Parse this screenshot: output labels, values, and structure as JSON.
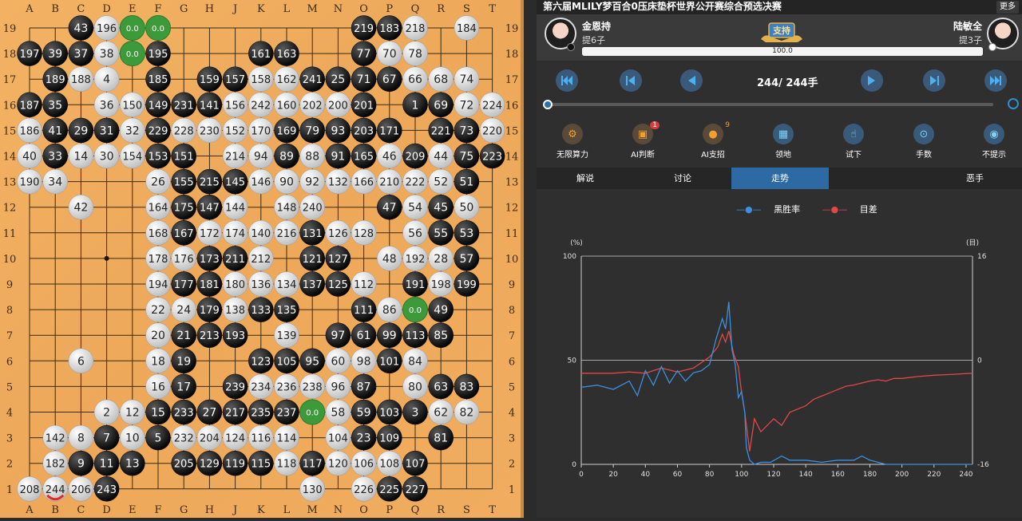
{
  "match_title": "第六届MLILY梦百合0压床垫杯世界公开赛综合预选决赛",
  "more_label": "更多",
  "black_player": {
    "name": "金恩持",
    "captures": "提6子"
  },
  "white_player": {
    "name": "陆敏全",
    "captures": "提3子"
  },
  "support_label": "支持",
  "win_progress": {
    "value": "100.0",
    "fraction": 1.0
  },
  "move_counter": "244/ 244手",
  "tools": [
    {
      "label": "无限算力",
      "icon": "compute-icon",
      "badge": ""
    },
    {
      "label": "AI判断",
      "icon": "ai-judge-icon",
      "badge": "1"
    },
    {
      "label": "AI支招",
      "icon": "bulb-icon",
      "badge": "9"
    },
    {
      "label": "领地",
      "icon": "territory-icon",
      "badge": ""
    },
    {
      "label": "试下",
      "icon": "hand-icon",
      "badge": ""
    },
    {
      "label": "手数",
      "icon": "move-number-icon",
      "badge": ""
    },
    {
      "label": "不提示",
      "icon": "eye-icon",
      "badge": ""
    }
  ],
  "tabs": [
    {
      "label": "解说",
      "active": false
    },
    {
      "label": "讨论",
      "active": false
    },
    {
      "label": "走势",
      "active": true
    },
    {
      "label": "",
      "active": false
    },
    {
      "label": "恶手",
      "active": false
    }
  ],
  "board": {
    "cols": [
      "A",
      "B",
      "C",
      "D",
      "E",
      "F",
      "G",
      "H",
      "J",
      "K",
      "L",
      "M",
      "N",
      "O",
      "P",
      "Q",
      "R",
      "S",
      "T"
    ],
    "rows": [
      "19",
      "18",
      "17",
      "16",
      "15",
      "14",
      "13",
      "12",
      "11",
      "10",
      "9",
      "8",
      "7",
      "6",
      "5",
      "4",
      "3",
      "2",
      "1"
    ],
    "stones": [
      [
        "C19",
        "b",
        43
      ],
      [
        "D19",
        "w",
        196
      ],
      [
        "O19",
        "b",
        219
      ],
      [
        "P19",
        "b",
        183
      ],
      [
        "Q19",
        "w",
        218
      ],
      [
        "S19",
        "w",
        184
      ],
      [
        "A18",
        "b",
        197
      ],
      [
        "B18",
        "b",
        39
      ],
      [
        "C18",
        "b",
        37
      ],
      [
        "D18",
        "w",
        38
      ],
      [
        "F18",
        "b",
        195
      ],
      [
        "K18",
        "b",
        161
      ],
      [
        "L18",
        "b",
        163
      ],
      [
        "O18",
        "b",
        77
      ],
      [
        "P18",
        "w",
        70
      ],
      [
        "Q18",
        "w",
        78
      ],
      [
        "B17",
        "b",
        189
      ],
      [
        "C17",
        "w",
        188
      ],
      [
        "D17",
        "w",
        4
      ],
      [
        "F17",
        "b",
        185
      ],
      [
        "H17",
        "b",
        159
      ],
      [
        "J17",
        "b",
        157
      ],
      [
        "K17",
        "w",
        158
      ],
      [
        "L17",
        "w",
        162
      ],
      [
        "M17",
        "b",
        241
      ],
      [
        "N17",
        "b",
        25
      ],
      [
        "O17",
        "b",
        71
      ],
      [
        "P17",
        "b",
        67
      ],
      [
        "Q17",
        "w",
        66
      ],
      [
        "R17",
        "w",
        68
      ],
      [
        "S17",
        "w",
        74
      ],
      [
        "A16",
        "b",
        187
      ],
      [
        "B16",
        "b",
        35
      ],
      [
        "D16",
        "w",
        36
      ],
      [
        "E16",
        "w",
        150
      ],
      [
        "F16",
        "b",
        149
      ],
      [
        "G16",
        "b",
        231
      ],
      [
        "H16",
        "b",
        141
      ],
      [
        "J16",
        "w",
        156
      ],
      [
        "K16",
        "w",
        242
      ],
      [
        "L16",
        "w",
        160
      ],
      [
        "M16",
        "w",
        202
      ],
      [
        "N16",
        "w",
        200
      ],
      [
        "O16",
        "b",
        201
      ],
      [
        "Q16",
        "b",
        1
      ],
      [
        "R16",
        "b",
        69
      ],
      [
        "S16",
        "w",
        72
      ],
      [
        "T16",
        "w",
        224
      ],
      [
        "A15",
        "w",
        186
      ],
      [
        "B15",
        "b",
        41
      ],
      [
        "C15",
        "b",
        29
      ],
      [
        "D15",
        "b",
        31
      ],
      [
        "E15",
        "w",
        32
      ],
      [
        "F15",
        "b",
        229
      ],
      [
        "G15",
        "w",
        228
      ],
      [
        "H15",
        "w",
        230
      ],
      [
        "J15",
        "w",
        152
      ],
      [
        "K15",
        "w",
        170
      ],
      [
        "L15",
        "b",
        169
      ],
      [
        "M15",
        "b",
        79
      ],
      [
        "N15",
        "b",
        93
      ],
      [
        "O15",
        "b",
        203
      ],
      [
        "P15",
        "b",
        171
      ],
      [
        "R15",
        "b",
        221
      ],
      [
        "S15",
        "b",
        73
      ],
      [
        "T15",
        "w",
        220
      ],
      [
        "A14",
        "w",
        40
      ],
      [
        "B14",
        "b",
        33
      ],
      [
        "C14",
        "w",
        14
      ],
      [
        "D14",
        "w",
        30
      ],
      [
        "E14",
        "w",
        154
      ],
      [
        "F14",
        "b",
        153
      ],
      [
        "G14",
        "b",
        151
      ],
      [
        "J14",
        "w",
        214
      ],
      [
        "K14",
        "w",
        94
      ],
      [
        "L14",
        "b",
        89
      ],
      [
        "M14",
        "w",
        88
      ],
      [
        "N14",
        "b",
        91
      ],
      [
        "O14",
        "b",
        165
      ],
      [
        "P14",
        "w",
        46
      ],
      [
        "Q14",
        "b",
        209
      ],
      [
        "R14",
        "w",
        44
      ],
      [
        "S14",
        "b",
        75
      ],
      [
        "T14",
        "b",
        223
      ],
      [
        "A13",
        "w",
        190
      ],
      [
        "B13",
        "w",
        34
      ],
      [
        "F13",
        "w",
        26
      ],
      [
        "G13",
        "b",
        155
      ],
      [
        "H13",
        "b",
        215
      ],
      [
        "J13",
        "b",
        145
      ],
      [
        "K13",
        "w",
        146
      ],
      [
        "L13",
        "w",
        90
      ],
      [
        "M13",
        "w",
        92
      ],
      [
        "N13",
        "w",
        132
      ],
      [
        "O13",
        "w",
        166
      ],
      [
        "P13",
        "w",
        210
      ],
      [
        "Q13",
        "w",
        222
      ],
      [
        "R13",
        "w",
        52
      ],
      [
        "S13",
        "b",
        51
      ],
      [
        "C12",
        "w",
        42
      ],
      [
        "F12",
        "w",
        164
      ],
      [
        "G12",
        "b",
        175
      ],
      [
        "H12",
        "b",
        147
      ],
      [
        "J12",
        "w",
        144
      ],
      [
        "L12",
        "w",
        148
      ],
      [
        "M12",
        "w",
        240
      ],
      [
        "P12",
        "b",
        47
      ],
      [
        "Q12",
        "w",
        54
      ],
      [
        "R12",
        "b",
        45
      ],
      [
        "S12",
        "w",
        50
      ],
      [
        "F11",
        "w",
        168
      ],
      [
        "G11",
        "b",
        167
      ],
      [
        "H11",
        "w",
        172
      ],
      [
        "J11",
        "w",
        174
      ],
      [
        "K11",
        "w",
        140
      ],
      [
        "L11",
        "w",
        216
      ],
      [
        "M11",
        "b",
        131
      ],
      [
        "N11",
        "w",
        126
      ],
      [
        "O11",
        "w",
        128
      ],
      [
        "Q11",
        "w",
        56
      ],
      [
        "R11",
        "b",
        55
      ],
      [
        "S11",
        "b",
        53
      ],
      [
        "F10",
        "w",
        178
      ],
      [
        "G10",
        "w",
        176
      ],
      [
        "H10",
        "b",
        173
      ],
      [
        "J10",
        "b",
        211
      ],
      [
        "K10",
        "w",
        212
      ],
      [
        "M10",
        "b",
        121
      ],
      [
        "N10",
        "b",
        127
      ],
      [
        "P10",
        "w",
        48
      ],
      [
        "Q10",
        "w",
        192
      ],
      [
        "R10",
        "w",
        28
      ],
      [
        "S10",
        "b",
        57
      ],
      [
        "F9",
        "w",
        194
      ],
      [
        "G9",
        "b",
        177
      ],
      [
        "H9",
        "b",
        181
      ],
      [
        "J9",
        "w",
        180
      ],
      [
        "K9",
        "w",
        136
      ],
      [
        "L9",
        "w",
        134
      ],
      [
        "M9",
        "b",
        137
      ],
      [
        "N9",
        "b",
        125
      ],
      [
        "O9",
        "w",
        112
      ],
      [
        "Q9",
        "b",
        191
      ],
      [
        "R9",
        "w",
        198
      ],
      [
        "S9",
        "b",
        199
      ],
      [
        "F8",
        "w",
        22
      ],
      [
        "G8",
        "w",
        24
      ],
      [
        "H8",
        "b",
        179
      ],
      [
        "J8",
        "w",
        138
      ],
      [
        "K8",
        "b",
        133
      ],
      [
        "L8",
        "b",
        135
      ],
      [
        "O8",
        "b",
        111
      ],
      [
        "P8",
        "w",
        86
      ],
      [
        "R8",
        "b",
        49
      ],
      [
        "F7",
        "w",
        20
      ],
      [
        "G7",
        "b",
        21
      ],
      [
        "H7",
        "b",
        213
      ],
      [
        "J7",
        "b",
        193
      ],
      [
        "L7",
        "w",
        139
      ],
      [
        "N7",
        "b",
        97
      ],
      [
        "O7",
        "b",
        61
      ],
      [
        "P7",
        "b",
        99
      ],
      [
        "Q7",
        "b",
        113
      ],
      [
        "R7",
        "b",
        85
      ],
      [
        "C6",
        "w",
        6
      ],
      [
        "F6",
        "w",
        18
      ],
      [
        "G6",
        "b",
        19
      ],
      [
        "K6",
        "b",
        123
      ],
      [
        "L6",
        "b",
        105
      ],
      [
        "M6",
        "b",
        95
      ],
      [
        "N6",
        "w",
        60
      ],
      [
        "O6",
        "w",
        98
      ],
      [
        "P6",
        "b",
        101
      ],
      [
        "Q6",
        "w",
        84
      ],
      [
        "F5",
        "w",
        16
      ],
      [
        "G5",
        "b",
        17
      ],
      [
        "J5",
        "b",
        239
      ],
      [
        "K5",
        "w",
        234
      ],
      [
        "L5",
        "w",
        236
      ],
      [
        "M5",
        "w",
        238
      ],
      [
        "N5",
        "w",
        96
      ],
      [
        "O5",
        "b",
        87
      ],
      [
        "Q5",
        "w",
        80
      ],
      [
        "R5",
        "b",
        63
      ],
      [
        "S5",
        "b",
        83
      ],
      [
        "D4",
        "w",
        2
      ],
      [
        "E4",
        "w",
        12
      ],
      [
        "F4",
        "b",
        15
      ],
      [
        "G4",
        "b",
        233
      ],
      [
        "H4",
        "b",
        27
      ],
      [
        "J4",
        "b",
        217
      ],
      [
        "K4",
        "b",
        235
      ],
      [
        "L4",
        "b",
        237
      ],
      [
        "N4",
        "w",
        58
      ],
      [
        "O4",
        "b",
        59
      ],
      [
        "P4",
        "b",
        103
      ],
      [
        "Q4",
        "b",
        3
      ],
      [
        "R4",
        "w",
        62
      ],
      [
        "S4",
        "w",
        82
      ],
      [
        "B3",
        "w",
        142
      ],
      [
        "C3",
        "w",
        8
      ],
      [
        "D3",
        "b",
        7
      ],
      [
        "E3",
        "w",
        10
      ],
      [
        "F3",
        "b",
        5
      ],
      [
        "G3",
        "w",
        232
      ],
      [
        "H3",
        "w",
        204
      ],
      [
        "J3",
        "w",
        124
      ],
      [
        "K3",
        "w",
        116
      ],
      [
        "L3",
        "w",
        114
      ],
      [
        "N3",
        "w",
        104
      ],
      [
        "O3",
        "b",
        23
      ],
      [
        "P3",
        "b",
        109
      ],
      [
        "R3",
        "b",
        81
      ],
      [
        "B2",
        "w",
        182
      ],
      [
        "C2",
        "b",
        9
      ],
      [
        "D2",
        "b",
        11
      ],
      [
        "E2",
        "b",
        13
      ],
      [
        "G2",
        "b",
        205
      ],
      [
        "H2",
        "b",
        129
      ],
      [
        "J2",
        "b",
        119
      ],
      [
        "K2",
        "b",
        115
      ],
      [
        "L2",
        "w",
        118
      ],
      [
        "M2",
        "b",
        117
      ],
      [
        "N2",
        "w",
        120
      ],
      [
        "O2",
        "w",
        106
      ],
      [
        "P2",
        "w",
        108
      ],
      [
        "Q2",
        "b",
        107
      ],
      [
        "A1",
        "w",
        208
      ],
      [
        "B1",
        "w",
        244
      ],
      [
        "C1",
        "w",
        206
      ],
      [
        "D1",
        "b",
        243
      ],
      [
        "M1",
        "w",
        130
      ],
      [
        "O1",
        "w",
        226
      ],
      [
        "P1",
        "b",
        225
      ],
      [
        "Q1",
        "b",
        227
      ]
    ],
    "markers": [
      [
        "E19",
        "0.0"
      ],
      [
        "F19",
        "0.0"
      ],
      [
        "E18",
        "0.0"
      ],
      [
        "Q8",
        "0.0"
      ],
      [
        "M4",
        "0.0"
      ]
    ],
    "last_move": "B1"
  },
  "chart_data": {
    "type": "line",
    "series": [
      {
        "name": "黑胜率",
        "color": "#3b8fe0"
      },
      {
        "name": "目差",
        "color": "#e0484a"
      }
    ],
    "left_axis_unit": "(%)",
    "right_axis_unit": "(目)",
    "y_left_ticks": [
      "100",
      "50",
      "0"
    ],
    "y_right_ticks": [
      "16",
      "0",
      "-16"
    ],
    "x_ticks": [
      "0",
      "20",
      "40",
      "60",
      "80",
      "100",
      "120",
      "140",
      "160",
      "180",
      "200",
      "220",
      "240"
    ],
    "xlim": [
      0,
      244
    ],
    "ylim_left": [
      0,
      100
    ],
    "ylim_right": [
      -16,
      16
    ],
    "winrate": [
      [
        0,
        37
      ],
      [
        10,
        38
      ],
      [
        20,
        36
      ],
      [
        30,
        40
      ],
      [
        35,
        33
      ],
      [
        40,
        45
      ],
      [
        45,
        38
      ],
      [
        50,
        47
      ],
      [
        55,
        39
      ],
      [
        60,
        45
      ],
      [
        65,
        40
      ],
      [
        70,
        44
      ],
      [
        75,
        45
      ],
      [
        80,
        48
      ],
      [
        84,
        60
      ],
      [
        88,
        70
      ],
      [
        90,
        65
      ],
      [
        92,
        78
      ],
      [
        94,
        55
      ],
      [
        96,
        48
      ],
      [
        98,
        32
      ],
      [
        100,
        35
      ],
      [
        102,
        25
      ],
      [
        103,
        8
      ],
      [
        105,
        2
      ],
      [
        108,
        0
      ],
      [
        112,
        1
      ],
      [
        118,
        1
      ],
      [
        125,
        4
      ],
      [
        130,
        2
      ],
      [
        140,
        2
      ],
      [
        150,
        1
      ],
      [
        160,
        2
      ],
      [
        170,
        2
      ],
      [
        175,
        4
      ],
      [
        180,
        2
      ],
      [
        185,
        1
      ],
      [
        190,
        0
      ],
      [
        244,
        0
      ]
    ],
    "score": [
      [
        0,
        -2
      ],
      [
        10,
        -2
      ],
      [
        20,
        -2
      ],
      [
        30,
        -1.8
      ],
      [
        40,
        -2
      ],
      [
        50,
        -1.2
      ],
      [
        60,
        -1.8
      ],
      [
        70,
        -1.2
      ],
      [
        80,
        0.5
      ],
      [
        85,
        2
      ],
      [
        88,
        4
      ],
      [
        90,
        2.8
      ],
      [
        92,
        4.5
      ],
      [
        95,
        1
      ],
      [
        98,
        -1
      ],
      [
        100,
        -5
      ],
      [
        102,
        -8
      ],
      [
        105,
        -14
      ],
      [
        108,
        -9
      ],
      [
        112,
        -11
      ],
      [
        116,
        -10
      ],
      [
        120,
        -9
      ],
      [
        125,
        -10
      ],
      [
        130,
        -8
      ],
      [
        135,
        -7.5
      ],
      [
        140,
        -7
      ],
      [
        145,
        -6
      ],
      [
        150,
        -5.5
      ],
      [
        155,
        -5
      ],
      [
        160,
        -4.5
      ],
      [
        165,
        -4
      ],
      [
        170,
        -3.8
      ],
      [
        175,
        -3.5
      ],
      [
        180,
        -3.2
      ],
      [
        185,
        -3
      ],
      [
        190,
        -3.2
      ],
      [
        195,
        -2.8
      ],
      [
        200,
        -2.8
      ],
      [
        210,
        -2.5
      ],
      [
        220,
        -2.3
      ],
      [
        230,
        -2.2
      ],
      [
        244,
        -2
      ]
    ]
  }
}
